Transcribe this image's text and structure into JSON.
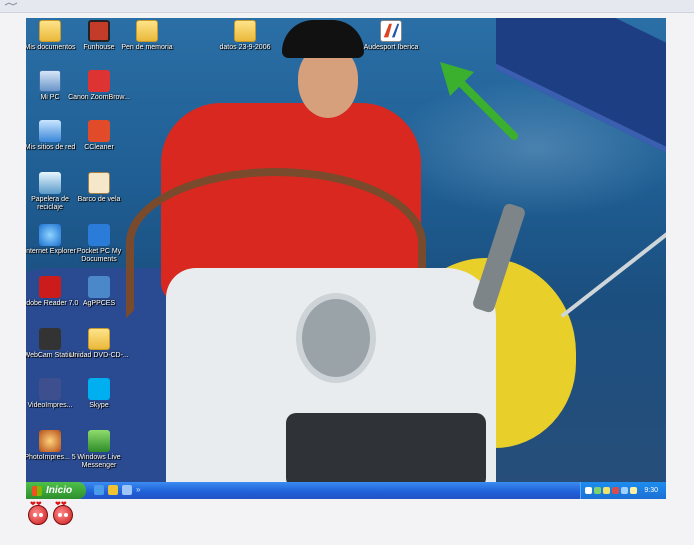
{
  "desktop": {
    "icons": [
      {
        "label": "Mis documentos"
      },
      {
        "label": "Funhouse"
      },
      {
        "label": "Pen de memoria"
      },
      {
        "label": "datos 23-9-2006"
      },
      {
        "label": "Audesport Iberica"
      },
      {
        "label": "Mi PC"
      },
      {
        "label": "Canon ZoomBrow..."
      },
      {
        "label": "Mis sitios de red"
      },
      {
        "label": "CCleaner"
      },
      {
        "label": "Papelera de reciclaje"
      },
      {
        "label": "Barco de vela"
      },
      {
        "label": "Internet Explorer"
      },
      {
        "label": "Pocket PC My Documents"
      },
      {
        "label": "Adobe Reader 7.0"
      },
      {
        "label": "AgPPCES"
      },
      {
        "label": "WebCam Station"
      },
      {
        "label": "Unidad DVD-CD-..."
      },
      {
        "label": "VideoImpres..."
      },
      {
        "label": "Skype"
      },
      {
        "label": "PhotoImpres... 5"
      },
      {
        "label": "Windows Live Messenger"
      }
    ]
  },
  "taskbar": {
    "start_label": "Inicio",
    "clock": "9:30"
  },
  "colors": {
    "taskbar": "#1f5fd6",
    "start": "#2d8f2c",
    "arrow": "#3bb02e"
  }
}
